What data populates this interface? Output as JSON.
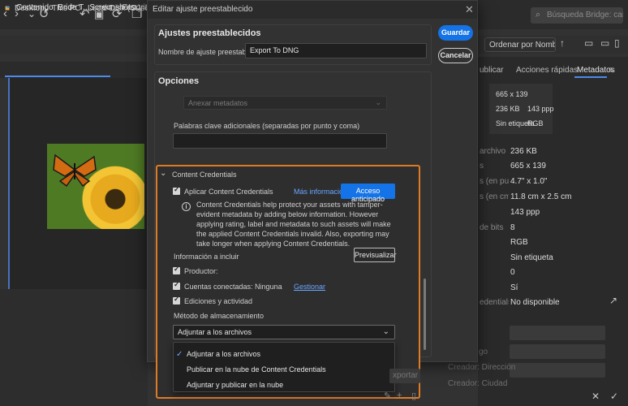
{
  "app": {
    "search_placeholder": "Búsqueda Bridge: carp",
    "breadcrumbs": [
      "Desktop",
      "This PC",
      "Local Disk (C:)",
      "Use"
    ],
    "tabs": [
      "Contenido: Bride T...Screenshots",
      "Favoritos"
    ],
    "sort_label": "Ordenar por Nombre",
    "right_tabs": [
      "ublicar",
      "Acciones rápidas",
      "Metadatos"
    ],
    "meta_summary": {
      "dims": "665 x 139",
      "size": "236 KB",
      "ppp": "143 ppp",
      "label": "Sin etiqueta",
      "mode": "RGB"
    },
    "meta_rows": [
      {
        "label": "archivo",
        "value": "236 KB"
      },
      {
        "label": "s",
        "value": "665 x 139"
      },
      {
        "label": "s (en pulg...",
        "value": "4.7\" x 1.0\""
      },
      {
        "label": "s (en cm)",
        "value": "11.8 cm x 2.5 cm"
      },
      {
        "label": "",
        "value": "143 ppp"
      },
      {
        "label": "de bits",
        "value": "8"
      },
      {
        "label": "",
        "value": "RGB"
      },
      {
        "label": "",
        "value": "Sin etiqueta"
      },
      {
        "label": "",
        "value": "0"
      },
      {
        "label": "",
        "value": "Sí"
      },
      {
        "label": "edentials",
        "value": "No disponible"
      }
    ],
    "right_labels": [
      "go",
      "Creador: Dirección",
      "Creador: Ciudad"
    ]
  },
  "dialog": {
    "title": "Editar ajuste preestablecido",
    "presets_title": "Ajustes preestablecidos",
    "preset_name_label": "Nombre de ajuste preestablecido",
    "preset_name_value": "Export To DNG",
    "save_label": "Guardar",
    "cancel_label": "Cancelar",
    "options_title": "Opciones",
    "attach_metadata_label": "Anexar metadatos",
    "keywords_label": "Palabras clave adicionales (separadas por punto y coma)",
    "keywords_value": "",
    "cc": {
      "title": "Content Credentials",
      "apply_label": "Aplicar Content Credentials",
      "more_info": "Más información",
      "early_access": "Acceso anticipado",
      "info_text": "Content Credentials help protect your assets with tamper-evident metadata by adding below information. However applying rating, label and metadata to such assets will make the applied Content Credentials invalid. Also, exporting may take longer when applying Content Credentials.",
      "include_label": "Información a incluir",
      "preview_label": "Previsualizar",
      "producer_label": "Productor:",
      "accounts_label": "Cuentas conectadas: Ninguna",
      "manage_label": "Gestionar",
      "edits_label": "Ediciones y actividad",
      "storage_label": "Método de almacenamiento",
      "storage_value": "Adjuntar a los archivos",
      "storage_options": [
        "Adjuntar a los archivos",
        "Publicar en la nube de Content Credentials",
        "Adjuntar y publicar en la nube"
      ]
    },
    "export_label": "xportar"
  }
}
